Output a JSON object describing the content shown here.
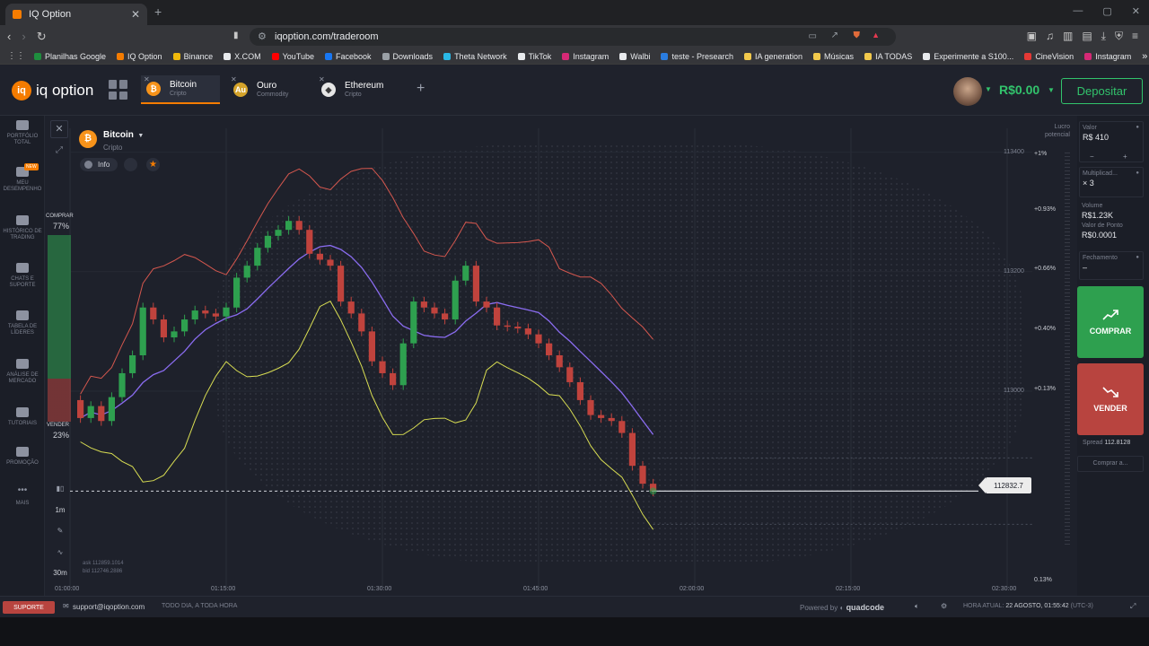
{
  "browser": {
    "tab_title": "IQ Option",
    "url": "iqoption.com/traderoom",
    "bookmarks": [
      {
        "label": "Planilhas Google",
        "color": "#1e8e3e"
      },
      {
        "label": "IQ Option",
        "color": "#f57c00"
      },
      {
        "label": "Binance",
        "color": "#f0b90b"
      },
      {
        "label": "X.COM",
        "color": "#e8eaed"
      },
      {
        "label": "YouTube",
        "color": "#ff0000"
      },
      {
        "label": "Facebook",
        "color": "#1877f2"
      },
      {
        "label": "Downloads",
        "color": "#9aa0a6"
      },
      {
        "label": "Theta Network",
        "color": "#2ab8e6"
      },
      {
        "label": "TikTok",
        "color": "#e8eaed"
      },
      {
        "label": "Instagram",
        "color": "#d62976"
      },
      {
        "label": "Walbi",
        "color": "#e8eaed"
      },
      {
        "label": "teste - Presearch",
        "color": "#2a7de1"
      },
      {
        "label": "IA generation",
        "color": "#f2c94c"
      },
      {
        "label": "Músicas",
        "color": "#f2c94c"
      },
      {
        "label": "IA TODAS",
        "color": "#f2c94c"
      },
      {
        "label": "Experimente a S100...",
        "color": "#e8eaed"
      },
      {
        "label": "CineVision",
        "color": "#e53935"
      },
      {
        "label": "Instagram",
        "color": "#d62976"
      }
    ]
  },
  "app": {
    "logo_text": "iq option",
    "tabs": [
      {
        "name": "Bitcoin",
        "sub": "Cripto",
        "icon": "bitcoin-icon",
        "color": "#f7931a",
        "glyph": "₿"
      },
      {
        "name": "Ouro",
        "sub": "Commodity",
        "icon": "gold-icon",
        "color": "#d4a32a",
        "glyph": "Au"
      },
      {
        "name": "Ethereum",
        "sub": "Cripto",
        "icon": "ethereum-icon",
        "color": "#3c3c3d",
        "glyph": "◆"
      }
    ],
    "balance": "R$0.00",
    "deposit_label": "Depositar"
  },
  "sidebar": [
    {
      "label": "PORTFÓLIO TOTAL",
      "icon": "portfolio-icon"
    },
    {
      "label": "MEU DESEMPENHO",
      "icon": "performance-icon",
      "badge": "NEW"
    },
    {
      "label": "HISTÓRICO DE TRADING",
      "icon": "history-icon"
    },
    {
      "label": "CHATS E SUPORTE",
      "icon": "chat-icon"
    },
    {
      "label": "TABELA DE LÍDERES",
      "icon": "leaderboard-icon"
    },
    {
      "label": "ANÁLISE DE MERCADO",
      "icon": "market-analysis-icon"
    },
    {
      "label": "TUTORIAIS",
      "icon": "tutorials-icon"
    },
    {
      "label": "PROMOÇÃO",
      "icon": "promo-icon"
    },
    {
      "label": "MAIS",
      "icon": "more-icon"
    }
  ],
  "asset": {
    "name": "Bitcoin",
    "sub": "Cripto",
    "info_label": "Info"
  },
  "sentiment": {
    "buy_label": "COMPRAR",
    "buy_pct": "77%",
    "sell_label": "VENDER",
    "sell_pct": "23%"
  },
  "tools": {
    "timeframe": "1m",
    "interval": "30m"
  },
  "quote": {
    "ask": "ask 112859.1014",
    "bid": "bid 112746.2886",
    "current_price": "112832.7"
  },
  "chart_data": {
    "type": "candlestick",
    "x_ticks": [
      "01:00:00",
      "01:15:00",
      "01:30:00",
      "01:45:00",
      "02:00:00",
      "02:15:00",
      "02:30:00"
    ],
    "y_ticks": [
      "113400",
      "113200",
      "113000"
    ],
    "profit_ticks": [
      "+1%",
      "+0.93%",
      "+0.66%",
      "+0.40%",
      "+0.13%",
      "0.13%"
    ],
    "profit_label": "Lucro potencial",
    "current_price": 112832.7,
    "ylim": [
      112680,
      113440
    ],
    "xlim_minutes": [
      0,
      90
    ],
    "candles": [
      {
        "t": 1.0,
        "o": 112985,
        "c": 112955
      },
      {
        "t": 2.0,
        "o": 112955,
        "c": 112975
      },
      {
        "t": 3.0,
        "o": 112975,
        "c": 112950
      },
      {
        "t": 4.0,
        "o": 112950,
        "c": 112990
      },
      {
        "t": 5.0,
        "o": 112990,
        "c": 113030
      },
      {
        "t": 6.0,
        "o": 113030,
        "c": 113060
      },
      {
        "t": 7.0,
        "o": 113060,
        "c": 113140
      },
      {
        "t": 8.0,
        "o": 113140,
        "c": 113120
      },
      {
        "t": 9.0,
        "o": 113120,
        "c": 113090
      },
      {
        "t": 10.0,
        "o": 113090,
        "c": 113100
      },
      {
        "t": 11.0,
        "o": 113100,
        "c": 113120
      },
      {
        "t": 12.0,
        "o": 113120,
        "c": 113135
      },
      {
        "t": 13.0,
        "o": 113135,
        "c": 113130
      },
      {
        "t": 14.0,
        "o": 113130,
        "c": 113125
      },
      {
        "t": 15.0,
        "o": 113125,
        "c": 113140
      },
      {
        "t": 16.0,
        "o": 113140,
        "c": 113190
      },
      {
        "t": 17.0,
        "o": 113190,
        "c": 113210
      },
      {
        "t": 18.0,
        "o": 113210,
        "c": 113240
      },
      {
        "t": 19.0,
        "o": 113240,
        "c": 113260
      },
      {
        "t": 20.0,
        "o": 113260,
        "c": 113270
      },
      {
        "t": 21.0,
        "o": 113270,
        "c": 113285
      },
      {
        "t": 22.0,
        "o": 113285,
        "c": 113270
      },
      {
        "t": 23.0,
        "o": 113270,
        "c": 113230
      },
      {
        "t": 24.0,
        "o": 113230,
        "c": 113220
      },
      {
        "t": 25.0,
        "o": 113220,
        "c": 113210
      },
      {
        "t": 26.0,
        "o": 113210,
        "c": 113150
      },
      {
        "t": 27.0,
        "o": 113150,
        "c": 113130
      },
      {
        "t": 28.0,
        "o": 113130,
        "c": 113100
      },
      {
        "t": 29.0,
        "o": 113100,
        "c": 113050
      },
      {
        "t": 30.0,
        "o": 113050,
        "c": 113030
      },
      {
        "t": 31.0,
        "o": 113030,
        "c": 113010
      },
      {
        "t": 32.0,
        "o": 113010,
        "c": 113080
      },
      {
        "t": 33.0,
        "o": 113080,
        "c": 113150
      },
      {
        "t": 34.0,
        "o": 113150,
        "c": 113140
      },
      {
        "t": 35.0,
        "o": 113140,
        "c": 113130
      },
      {
        "t": 36.0,
        "o": 113130,
        "c": 113120
      },
      {
        "t": 37.0,
        "o": 113120,
        "c": 113185
      },
      {
        "t": 38.0,
        "o": 113185,
        "c": 113210
      },
      {
        "t": 39.0,
        "o": 113210,
        "c": 113150
      },
      {
        "t": 40.0,
        "o": 113150,
        "c": 113140
      },
      {
        "t": 41.0,
        "o": 113140,
        "c": 113110
      },
      {
        "t": 42.0,
        "o": 113110,
        "c": 113108
      },
      {
        "t": 43.0,
        "o": 113108,
        "c": 113105
      },
      {
        "t": 44.0,
        "o": 113105,
        "c": 113095
      },
      {
        "t": 45.0,
        "o": 113095,
        "c": 113080
      },
      {
        "t": 46.0,
        "o": 113080,
        "c": 113060
      },
      {
        "t": 47.0,
        "o": 113060,
        "c": 113040
      },
      {
        "t": 48.0,
        "o": 113040,
        "c": 113015
      },
      {
        "t": 49.0,
        "o": 113015,
        "c": 112985
      },
      {
        "t": 50.0,
        "o": 112985,
        "c": 112960
      },
      {
        "t": 51.0,
        "o": 112960,
        "c": 112955
      },
      {
        "t": 52.0,
        "o": 112955,
        "c": 112950
      },
      {
        "t": 53.0,
        "o": 112950,
        "c": 112930
      },
      {
        "t": 54.0,
        "o": 112930,
        "c": 112875
      },
      {
        "t": 55.0,
        "o": 112875,
        "c": 112845
      },
      {
        "t": 56.0,
        "o": 112845,
        "c": 112832
      }
    ]
  },
  "trade": {
    "valor_label": "Valor",
    "valor": "R$ 410",
    "mult_label": "Multiplicad...",
    "mult": "× 3",
    "volume_label": "Volume",
    "volume": "R$1.23K",
    "ponto_label": "Valor de Ponto",
    "ponto": "R$0.0001",
    "fech_label": "Fechamento",
    "fech": "–",
    "buy_label": "COMPRAR",
    "sell_label": "VENDER",
    "spread_label": "Spread",
    "spread": "112.8128",
    "buy_at": "Comprar a..."
  },
  "footer": {
    "support": "SUPORTE",
    "email": "support@iqoption.com",
    "allday": "TODO DIA, A TODA HORA",
    "powered": "Powered by",
    "brand": "quadcode",
    "clock_label": "HORA ATUAL:",
    "clock": "22 AGOSTO, 01:55:42",
    "tz": "(UTC-3)"
  }
}
